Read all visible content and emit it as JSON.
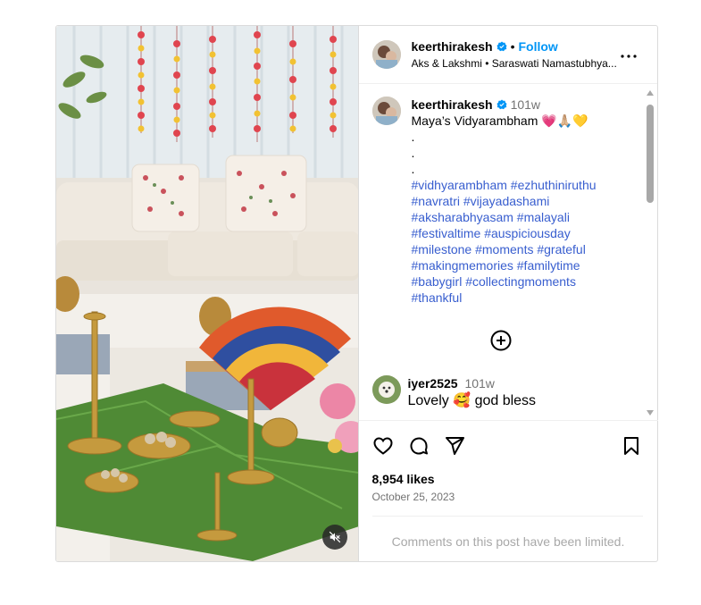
{
  "header": {
    "username": "keerthirakesh",
    "follow_label": "Follow",
    "separator": "•",
    "subtitle": "Aks & Lakshmi • Saraswati Namastubhya..."
  },
  "caption": {
    "username": "keerthirakesh",
    "age": "101w",
    "title": "Maya’s Vidyarambham 💗🙏🏼💛",
    "dots": [
      ".",
      ".",
      "."
    ],
    "hashtags": [
      [
        "#vidhyarambham",
        "#ezhuthiniruthu"
      ],
      [
        "#navratri",
        "#vijayadashami"
      ],
      [
        "#aksharabhyasam",
        "#malayali"
      ],
      [
        "#festivaltime",
        "#auspiciousday"
      ],
      [
        "#milestone",
        "#moments",
        "#grateful"
      ],
      [
        "#makingmemories",
        "#familytime"
      ],
      [
        "#babygirl",
        "#collectingmoments"
      ],
      [
        "#thankful"
      ]
    ]
  },
  "comment": {
    "username": "iyer2525",
    "age": "101w",
    "text": "Lovely 🥰 god bless"
  },
  "stats": {
    "likes": "8,954 likes",
    "date": "October 25, 2023"
  },
  "footer": {
    "limited": "Comments on this post have been limited."
  },
  "icons": {
    "more": "more-options-icon",
    "like": "heart-icon",
    "comment": "comment-icon",
    "share": "share-icon",
    "save": "bookmark-icon",
    "load_more": "plus-circle-icon",
    "mute": "muted-speaker-icon",
    "verified": "verified-badge-icon"
  },
  "colors": {
    "link_blue": "#0095f6",
    "hashtag": "#385ecf",
    "verified": "#0095f6",
    "muted_text": "#737373"
  }
}
